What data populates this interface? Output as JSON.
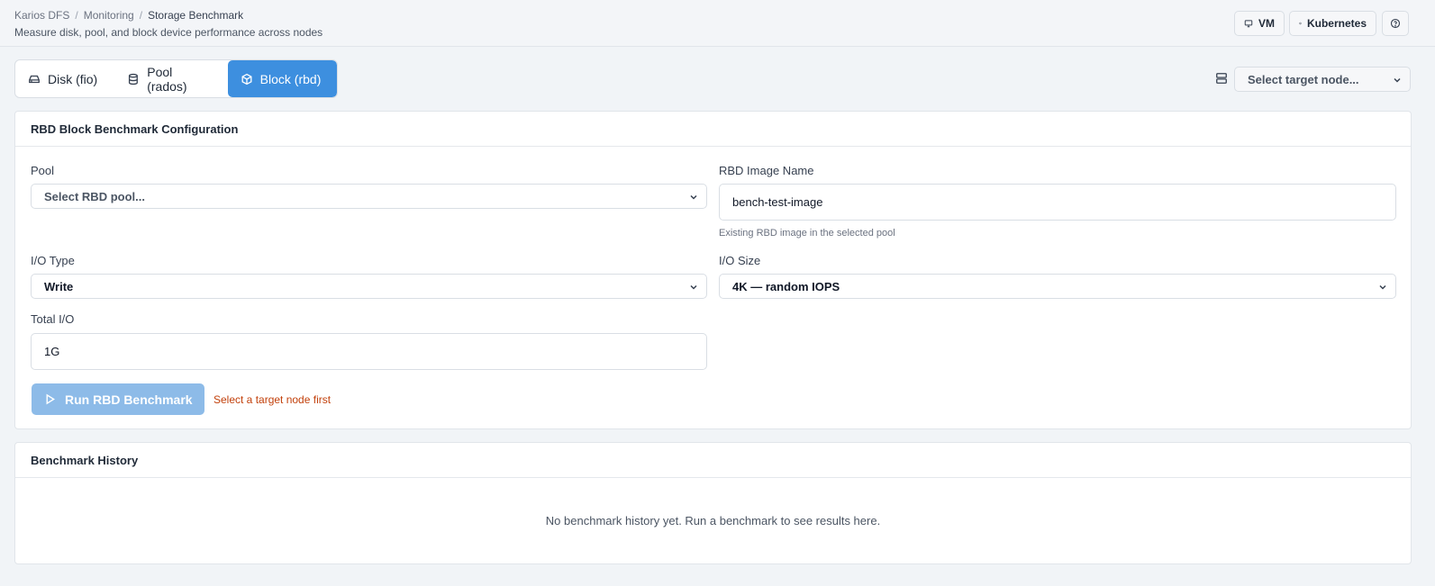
{
  "header": {
    "breadcrumb": [
      "Karios DFS",
      "Monitoring",
      "Storage Benchmark"
    ],
    "separator": "/",
    "subtitle": "Measure disk, pool, and block device performance across nodes",
    "buttons": {
      "vm": "VM",
      "kubernetes": "Kubernetes"
    }
  },
  "tabs": [
    {
      "label": "Disk (fio)",
      "icon": "hard-drive-icon",
      "active": false
    },
    {
      "label": "Pool (rados)",
      "icon": "database-icon",
      "active": false
    },
    {
      "label": "Block (rbd)",
      "icon": "cube-icon",
      "active": true
    }
  ],
  "node_select": {
    "placeholder": "Select target node..."
  },
  "config": {
    "title": "RBD Block Benchmark Configuration",
    "pool": {
      "label": "Pool",
      "placeholder": "Select RBD pool..."
    },
    "image": {
      "label": "RBD Image Name",
      "value": "bench-test-image",
      "hint": "Existing RBD image in the selected pool"
    },
    "io_type": {
      "label": "I/O Type",
      "value": "Write"
    },
    "io_size": {
      "label": "I/O Size",
      "value": "4K — random IOPS"
    },
    "total_io": {
      "label": "Total I/O",
      "value": "1G"
    },
    "run_button": "Run RBD Benchmark",
    "warning": "Select a target node first"
  },
  "history": {
    "title": "Benchmark History",
    "empty": "No benchmark history yet. Run a benchmark to see results here."
  },
  "colors": {
    "accent": "#3d8fdf",
    "disabled_accent": "#8dbbe8",
    "warning": "#c2410c"
  }
}
